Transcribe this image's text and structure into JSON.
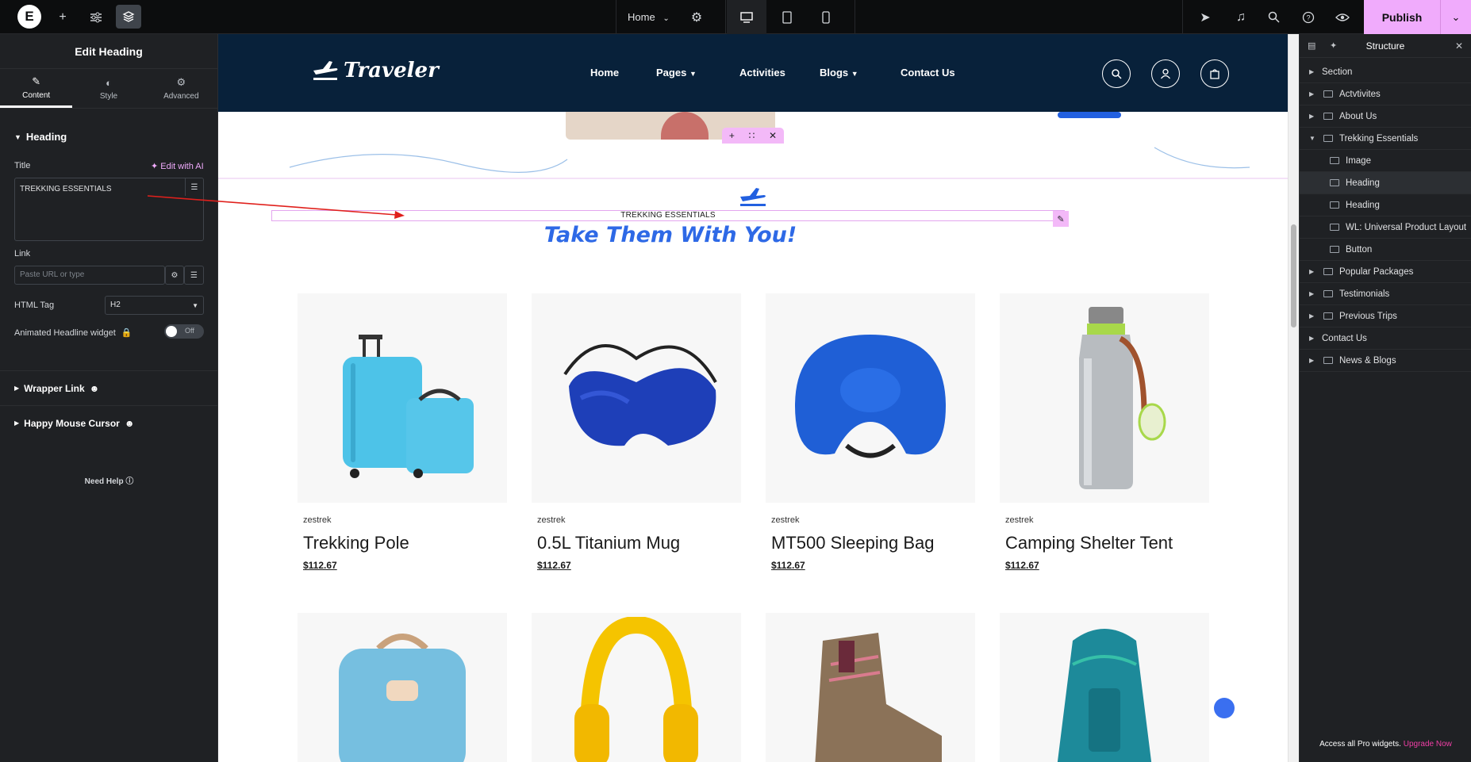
{
  "topbar": {
    "page_select": "Home",
    "publish_label": "Publish"
  },
  "left_panel": {
    "title": "Edit Heading",
    "tabs": [
      {
        "label": "Content",
        "icon": "pencil-icon"
      },
      {
        "label": "Style",
        "icon": "half-circle-icon"
      },
      {
        "label": "Advanced",
        "icon": "gear-icon"
      }
    ],
    "section_heading": "Heading",
    "title_label": "Title",
    "edit_ai_label": "Edit with AI",
    "title_value": "TREKKING ESSENTIALS",
    "link_label": "Link",
    "link_placeholder": "Paste URL or type",
    "html_tag_label": "HTML Tag",
    "html_tag_value": "H2",
    "animated_label": "Animated Headline widget",
    "toggle_off": "Off",
    "wrapper_link": "Wrapper Link",
    "happy_cursor": "Happy Mouse Cursor",
    "need_help": "Need Help"
  },
  "site": {
    "brand": "Traveler",
    "nav": [
      "Home",
      "Pages",
      "Activities",
      "Blogs",
      "Contact Us"
    ],
    "heading": "TREKKING ESSENTIALS",
    "subheading": "Take Them With You!",
    "products": [
      {
        "vendor": "zestrek",
        "title": "Trekking Pole",
        "price": "$112.67"
      },
      {
        "vendor": "zestrek",
        "title": "0.5L Titanium Mug",
        "price": "$112.67"
      },
      {
        "vendor": "zestrek",
        "title": "MT500 Sleeping Bag",
        "price": "$112.67"
      },
      {
        "vendor": "zestrek",
        "title": "Camping Shelter Tent",
        "price": "$112.67"
      }
    ]
  },
  "right_panel": {
    "title": "Structure",
    "tree": [
      {
        "label": "Section",
        "depth": 0,
        "caret": "right",
        "icon": false
      },
      {
        "label": "Actvtivites",
        "depth": 0,
        "caret": "right",
        "icon": true
      },
      {
        "label": "About Us",
        "depth": 0,
        "caret": "right",
        "icon": true
      },
      {
        "label": "Trekking Essentials",
        "depth": 0,
        "caret": "down",
        "icon": true
      },
      {
        "label": "Image",
        "depth": 1,
        "caret": "",
        "icon": true
      },
      {
        "label": "Heading",
        "depth": 1,
        "caret": "",
        "icon": true,
        "selected": true
      },
      {
        "label": "Heading",
        "depth": 1,
        "caret": "",
        "icon": true
      },
      {
        "label": "WL: Universal Product Layout",
        "depth": 1,
        "caret": "",
        "icon": true
      },
      {
        "label": "Button",
        "depth": 1,
        "caret": "",
        "icon": true
      },
      {
        "label": "Popular Packages",
        "depth": 0,
        "caret": "right",
        "icon": true
      },
      {
        "label": "Testimonials",
        "depth": 0,
        "caret": "right",
        "icon": true
      },
      {
        "label": "Previous Trips",
        "depth": 0,
        "caret": "right",
        "icon": true
      },
      {
        "label": "Contact Us",
        "depth": 0,
        "caret": "right",
        "icon": false
      },
      {
        "label": "News & Blogs",
        "depth": 0,
        "caret": "right",
        "icon": true
      }
    ],
    "footer_text": "Access all Pro widgets.",
    "footer_link": "Upgrade Now"
  }
}
